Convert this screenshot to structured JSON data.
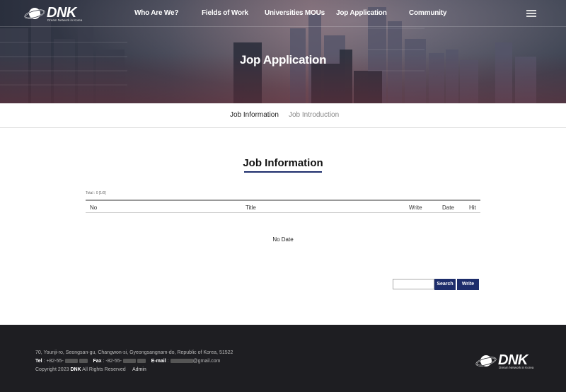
{
  "header": {
    "logo_text": "DNK",
    "logo_subtitle": "Dream Network in Korea",
    "nav": [
      "Who Are We?",
      "Fields of Work",
      "Universities MOUs",
      "Jop Application",
      "Community"
    ],
    "menu_icon": "hamburger-icon"
  },
  "hero": {
    "title": "Jop Application"
  },
  "subnav": {
    "tabs": [
      "Job Information",
      "Job Introduction"
    ],
    "active": "Job Information"
  },
  "board": {
    "title": "Job Information",
    "total": "Total : 0 [1/0]",
    "columns": [
      "No",
      "Title",
      "Write",
      "Date",
      "Hit"
    ],
    "empty_message": "No Date",
    "search_value": "",
    "search_button": "Search",
    "write_button": "Write"
  },
  "footer": {
    "address": "70, Younji-ro, Seongsan-gu, Changwon-si, Gyeongsangnam-do, Republic of Korea, 51522",
    "tel_label": "Tel",
    "tel_value": ": +82-55-",
    "fax_label": "Fax",
    "fax_value": ": -82-55-",
    "email_label": "E-mail",
    "email_value": ":",
    "email_suffix": "@gmail.com",
    "copyright_prefix": "Copyright 2023",
    "copyright_brand": "DNK",
    "copyright_suffix": "All Rights Reserved",
    "admin_link": "Admin"
  },
  "colors": {
    "accent": "#1d2d6b",
    "footer_bg": "#1e1e22"
  }
}
